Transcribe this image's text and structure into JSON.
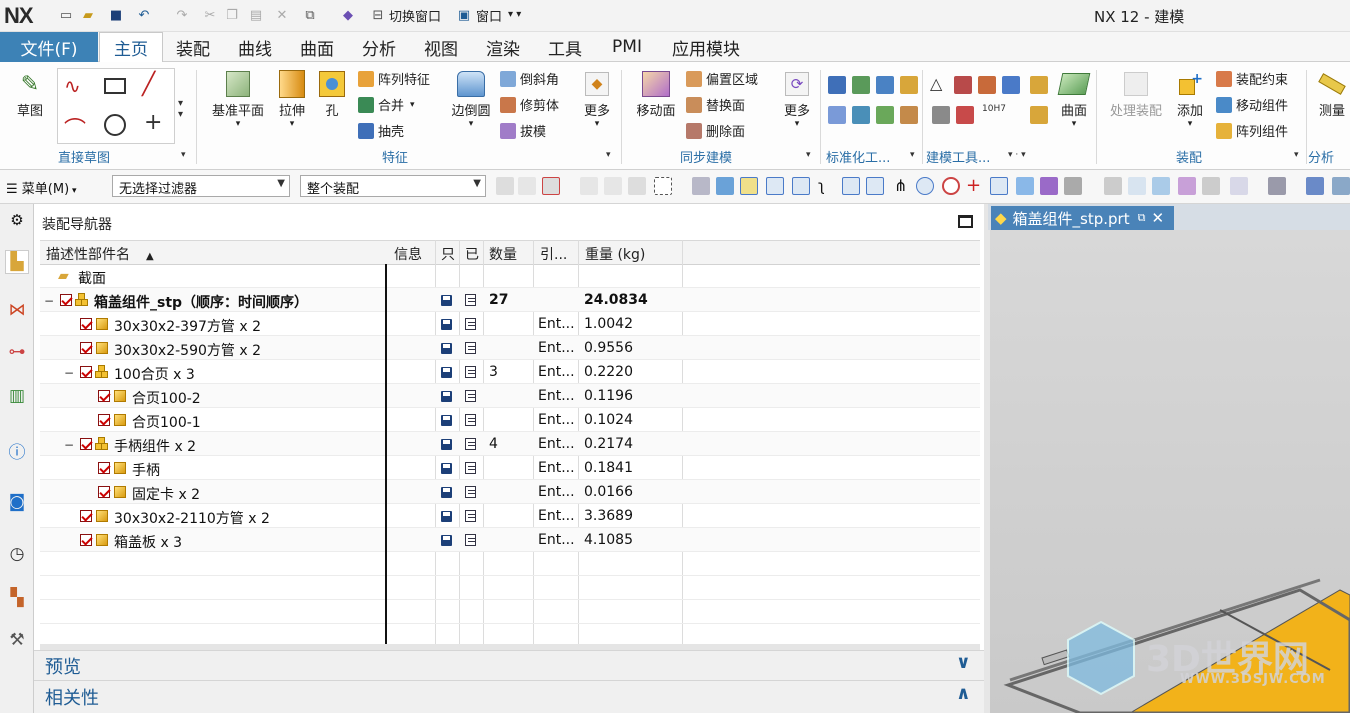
{
  "app": {
    "logo": "NX",
    "title": "NX 12 - 建模",
    "qat_switch_window": "切换窗口",
    "qat_window": "窗口"
  },
  "menu": {
    "file": "文件(F)",
    "tabs": [
      "主页",
      "装配",
      "曲线",
      "曲面",
      "分析",
      "视图",
      "渲染",
      "工具",
      "PMI",
      "应用模块"
    ],
    "active_tab": "主页"
  },
  "ribbon": {
    "sketch": "草图",
    "groups": {
      "direct_sketch": "直接草图",
      "feature": "特征",
      "sync": "同步建模",
      "std": "标准化工...",
      "modeling_tools": "建模工具...",
      "assembly": "装配",
      "analysis": "分析"
    },
    "feature_big": [
      "基准平面",
      "拉伸",
      "孔"
    ],
    "feature_small": [
      "阵列特征",
      "合并",
      "抽壳"
    ],
    "edge_blend": "边倒圆",
    "feature_small2": [
      "倒斜角",
      "修剪体",
      "拔模"
    ],
    "more": "更多",
    "move_face": "移动面",
    "sync_small": [
      "偏置区域",
      "替换面",
      "删除面"
    ],
    "surface": "曲面",
    "process_asm": "处理装配",
    "add": "添加",
    "asm_small": [
      "装配约束",
      "移动组件",
      "阵列组件"
    ],
    "measure": "测量"
  },
  "toolbar2": {
    "menu": "菜单(M)",
    "filter": "无选择过滤器",
    "scope": "整个装配"
  },
  "navigator": {
    "title": "装配导航器",
    "columns": [
      "描述性部件名",
      "信息",
      "只",
      "已",
      "数量",
      "引...",
      "重量 (kg)"
    ],
    "rows": [
      {
        "name": "截面",
        "qty": "",
        "ref": "",
        "weight": "",
        "level": 0,
        "type": "folder"
      },
      {
        "name": "箱盖组件_stp（顺序：时间顺序）",
        "qty": "27",
        "ref": "",
        "weight": "24.0834",
        "level": 0,
        "type": "asm-root"
      },
      {
        "name": "30x30x2-397方管 x 2",
        "qty": "",
        "ref": "Ent...",
        "weight": "1.0042",
        "level": 1,
        "type": "part"
      },
      {
        "name": "30x30x2-590方管 x 2",
        "qty": "",
        "ref": "Ent...",
        "weight": "0.9556",
        "level": 1,
        "type": "part"
      },
      {
        "name": "100合页 x 3",
        "qty": "3",
        "ref": "Ent...",
        "weight": "0.2220",
        "level": 1,
        "type": "asm"
      },
      {
        "name": "合页100-2",
        "qty": "",
        "ref": "Ent...",
        "weight": "0.1196",
        "level": 2,
        "type": "part"
      },
      {
        "name": "合页100-1",
        "qty": "",
        "ref": "Ent...",
        "weight": "0.1024",
        "level": 2,
        "type": "part"
      },
      {
        "name": "手柄组件 x 2",
        "qty": "4",
        "ref": "Ent...",
        "weight": "0.2174",
        "level": 1,
        "type": "asm"
      },
      {
        "name": "手柄",
        "qty": "",
        "ref": "Ent...",
        "weight": "0.1841",
        "level": 2,
        "type": "part"
      },
      {
        "name": "固定卡 x 2",
        "qty": "",
        "ref": "Ent...",
        "weight": "0.0166",
        "level": 2,
        "type": "part"
      },
      {
        "name": "30x30x2-2110方管 x 2",
        "qty": "",
        "ref": "Ent...",
        "weight": "3.3689",
        "level": 1,
        "type": "part"
      },
      {
        "name": "箱盖板 x 3",
        "qty": "",
        "ref": "Ent...",
        "weight": "4.1085",
        "level": 1,
        "type": "part"
      }
    ],
    "preview": "预览",
    "dependencies": "相关性"
  },
  "graphics": {
    "tab": "箱盖组件_stp.prt"
  },
  "watermark": {
    "main": "3D世界网",
    "sub": "WWW.3DSJW.COM"
  }
}
